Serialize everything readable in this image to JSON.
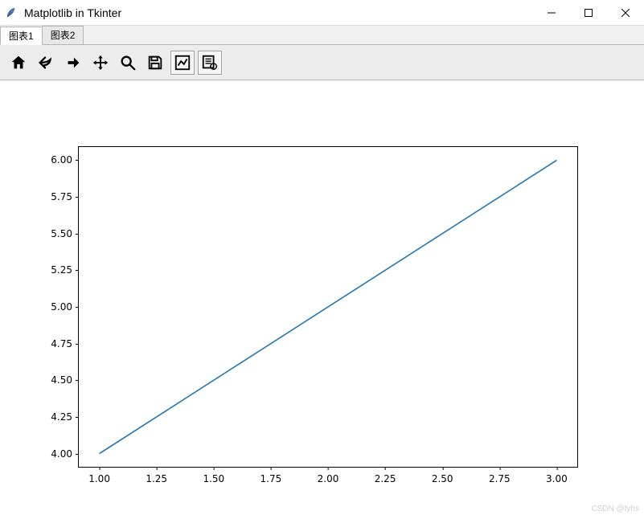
{
  "window": {
    "title": "Matplotlib in Tkinter"
  },
  "tabs": [
    {
      "label": "图表1",
      "active": true
    },
    {
      "label": "图表2",
      "active": false
    }
  ],
  "toolbar_icons": [
    "home-icon",
    "back-icon",
    "forward-icon",
    "pan-icon",
    "zoom-icon",
    "save-icon",
    "subplots-icon",
    "figure-options-icon"
  ],
  "watermark": "CSDN @fyhs",
  "chart_data": {
    "type": "line",
    "x": [
      1,
      2,
      3
    ],
    "y": [
      4,
      5,
      6
    ],
    "xticks": [
      "1.00",
      "1.25",
      "1.50",
      "1.75",
      "2.00",
      "2.25",
      "2.50",
      "2.75",
      "3.00"
    ],
    "yticks": [
      "4.00",
      "4.25",
      "4.50",
      "4.75",
      "5.00",
      "5.25",
      "5.50",
      "5.75",
      "6.00"
    ],
    "xlim": [
      1.0,
      3.0
    ],
    "ylim": [
      4.0,
      6.0
    ],
    "title": "",
    "xlabel": "",
    "ylabel": "",
    "line_color": "#1f77b4"
  }
}
